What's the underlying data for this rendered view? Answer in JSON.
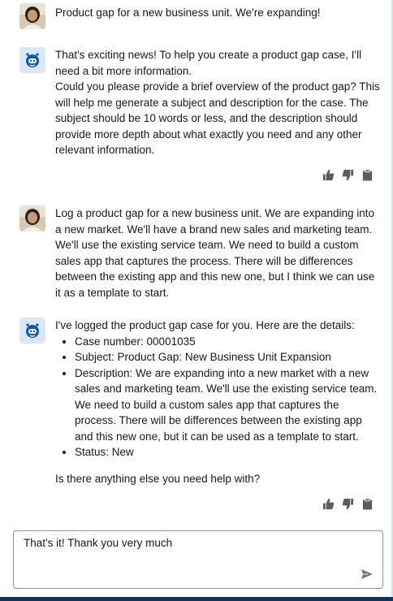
{
  "conversation": [
    {
      "role": "user",
      "avatar": "user-photo-avatar",
      "text": "Product gap for a new business unit. We're expanding!"
    },
    {
      "role": "assistant",
      "avatar": "bot-icon",
      "paragraphs": [
        "That's exciting news! To help you create a product gap case, I'll need a bit more information.",
        "Could you please provide a brief overview of the product gap? This will help me generate a subject and description for the case. The subject should be 10 words or less, and the description should provide more depth about what exactly you need and any other relevant information."
      ]
    },
    {
      "role": "user",
      "avatar": "user-photo-avatar",
      "text": "Log a product gap for a new business unit. We are expanding into a new market. We'll have a brand new sales and marketing team. We'll use the existing service team. We need to build a custom sales app that captures the process. There will be differences between the existing app and this new one, but I think we can use it as a template to start."
    },
    {
      "role": "assistant",
      "avatar": "bot-icon",
      "intro": "I've logged the product gap case for you. Here are the details:",
      "details": [
        "Case number: 00001035",
        "Subject: Product Gap: New Business Unit Expansion",
        "Description: We are expanding into a new market with a new sales and marketing team. We'll use the existing service team. We need to build a custom sales app that captures the process. There will be differences between the existing app and this new one, but it can be used as a template to start.",
        "Status: New"
      ],
      "closing": "Is there anything else you need help with?"
    }
  ],
  "feedback_icons": [
    "thumbs-up-icon",
    "thumbs-down-icon",
    "clipboard-copy-icon"
  ],
  "composer": {
    "value": "That's it! Thank you very much",
    "send_icon": "send-icon"
  },
  "colors": {
    "bot_avatar_bg": "#dbe7f6",
    "bot_icon": "#0b5cab",
    "feedback_icon": "#5c5c5c",
    "composer_border": "#939393",
    "bottom_bar": "#16325c"
  }
}
